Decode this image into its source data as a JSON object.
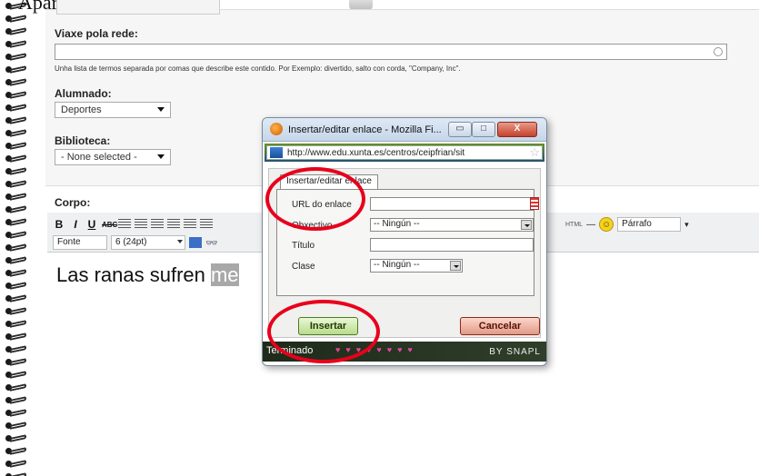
{
  "page": {
    "top_caption": "Aparecerá o seguinte:"
  },
  "form": {
    "partial_field": "",
    "viaxe_label": "Viaxe pola rede:",
    "viaxe_value": "",
    "viaxe_hint": "Unha lista de termos separada por comas que describe este contido. Por Exemplo: divertido, salto con corda, \"Company, Inc\".",
    "alumnado_label": "Alumnado:",
    "alumnado_value": "Deportes",
    "biblioteca_label": "Biblioteca:",
    "biblioteca_value": "- None selected -"
  },
  "editor": {
    "label": "Corpo:",
    "toolbar_row1": [
      "B",
      "I",
      "U",
      "ABC"
    ],
    "font_select": "Fonte",
    "size_select": "6 (24pt)",
    "html_label": "HTML",
    "dash": "—",
    "paragraph_select": "Párrafo",
    "content_text": "Las ranas sufren ",
    "content_selected": "me"
  },
  "popup": {
    "title": "Insertar/editar enlace - Mozilla Fi...",
    "url": "http://www.edu.xunta.es/centros/ceipfrian/sit",
    "tab_label": "Insertar/editar enlace",
    "url_field_label": "URL do enlace",
    "url_field_value": "",
    "target_label": "Obxectivo",
    "target_value": "-- Ningún --",
    "title_label": "Título",
    "title_value": "",
    "class_label": "Clase",
    "class_value": "-- Ningún --",
    "insert_button": "Insertar",
    "cancel_button": "Cancelar",
    "status_text": "Terminado",
    "status_brand": "BY SNAPL",
    "minimize": "▭",
    "maximize": "□",
    "close": "X"
  },
  "colors": {
    "highlight_ring": "#e8001c",
    "insert_button": "#b8dc8c",
    "cancel_button": "#e29a86"
  }
}
